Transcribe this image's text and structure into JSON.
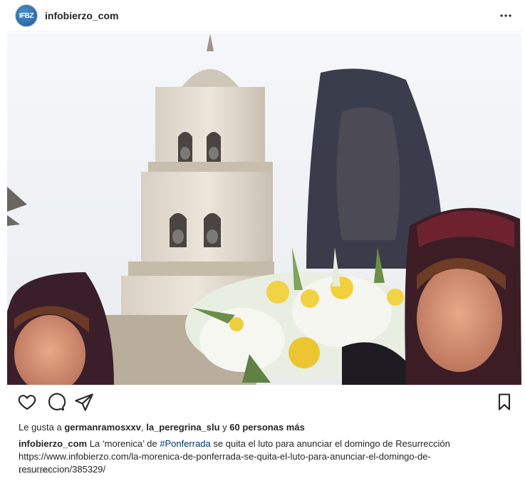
{
  "header": {
    "avatar_text": "IFBZ",
    "username": "infobierzo_com",
    "more_icon": "more-horizontal-icon"
  },
  "photo": {
    "subject": "procession-photo"
  },
  "actions": {
    "like_icon": "heart-icon",
    "comment_icon": "comment-icon",
    "share_icon": "paper-plane-icon",
    "save_icon": "bookmark-icon"
  },
  "likes": {
    "prefix": "Le gusta a ",
    "user1": "germanramosxxv",
    "sep": ", ",
    "user2": "la_peregrina_slu",
    "conj": " y ",
    "others": "60 personas más"
  },
  "caption": {
    "username": "infobierzo_com",
    "text_before": " La ‘morenica’ de ",
    "hashtag": "#Ponferrada",
    "text_after": " se quita el luto para anunciar el domingo de Resurrección https://www.infobierzo.com/la-morenica-de-ponferrada-se-quita-el-luto-para-anunciar-el-domingo-de-resurreccion/385329/"
  },
  "date": "1 DE ABRIL",
  "colors": {
    "text": "#262626",
    "hashtag": "#003569",
    "muted": "#999999"
  }
}
